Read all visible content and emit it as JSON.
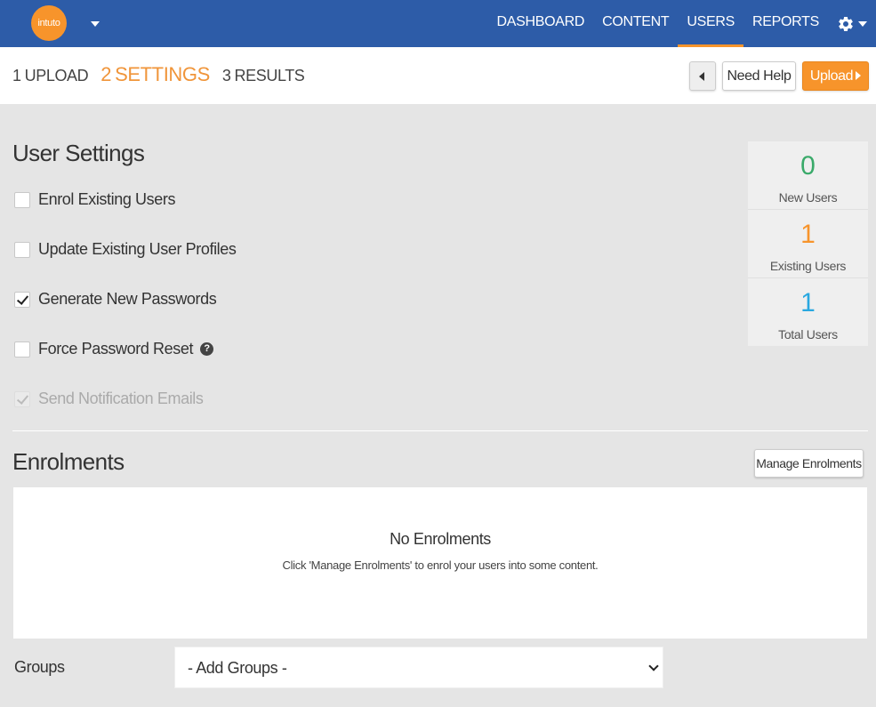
{
  "nav": {
    "logo_text": "intuto",
    "items": [
      {
        "label": "DASHBOARD",
        "active": false
      },
      {
        "label": "CONTENT",
        "active": false
      },
      {
        "label": "USERS",
        "active": true
      },
      {
        "label": "REPORTS",
        "active": false
      }
    ],
    "settings_icon": "gear-icon",
    "accent_color": "#f7942b",
    "bar_color": "#2d5ca8"
  },
  "steps": [
    {
      "num": "1",
      "label": "UPLOAD",
      "active": false
    },
    {
      "num": "2",
      "label": "SETTINGS",
      "active": true
    },
    {
      "num": "3",
      "label": "RESULTS",
      "active": false
    }
  ],
  "actions": {
    "prev_icon": "caret-left-icon",
    "help_label": "Need Help",
    "upload_label": "Upload"
  },
  "user_settings": {
    "title": "User Settings",
    "options": [
      {
        "label": "Enrol Existing Users",
        "checked": false,
        "disabled": false
      },
      {
        "label": "Update Existing User Profiles",
        "checked": false,
        "disabled": false
      },
      {
        "label": "Generate New Passwords",
        "checked": true,
        "disabled": false
      },
      {
        "label": "Force Password Reset",
        "checked": false,
        "disabled": false,
        "help": "?"
      },
      {
        "label": "Send Notification Emails",
        "checked": true,
        "disabled": true
      }
    ]
  },
  "stats": [
    {
      "value": "0",
      "label": "New Users",
      "color": "#3aaa6a"
    },
    {
      "value": "1",
      "label": "Existing Users",
      "color": "#f7942b"
    },
    {
      "value": "1",
      "label": "Total Users",
      "color": "#29a8e0"
    }
  ],
  "enrolments": {
    "title": "Enrolments",
    "manage_label": "Manage Enrolments",
    "empty_title": "No Enrolments",
    "empty_text": "Click 'Manage Enrolments' to enrol your users into some content."
  },
  "groups": {
    "label": "Groups",
    "selected": "- Add Groups -"
  }
}
